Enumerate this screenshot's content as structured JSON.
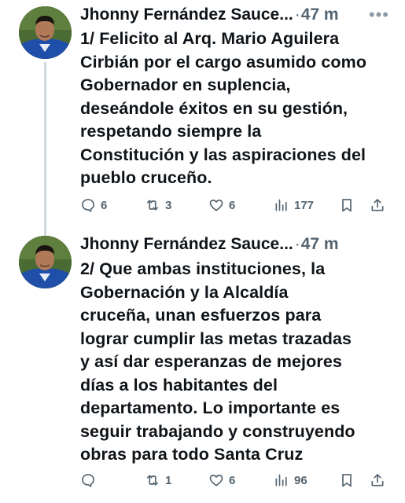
{
  "tweets": [
    {
      "author": "Jhonny Fernández Sauce...",
      "time": "47 m",
      "text": "1/ Felicito al Arq. Mario Aguilera\nCirbián por el cargo asumido como\nGobernador en suplencia,\ndeseándole éxitos en su gestión,\nrespetando siempre la\nConstitución y las aspiraciones del\npueblo cruceño.",
      "replies": "6",
      "reposts": "3",
      "likes": "6",
      "views": "177"
    },
    {
      "author": "Jhonny Fernández Sauce...",
      "time": "47 m",
      "text": "2/ Que ambas instituciones, la\nGobernación y la Alcaldía\ncruceña, unan esfuerzos para\nlograr cumplir las metas trazadas\ny así dar esperanzas de mejores\ndías a los habitantes del\ndepartamento. Lo importante es\nseguir trabajando y construyendo\nobras para todo Santa Cruz",
      "replies": "",
      "reposts": "1",
      "likes": "6",
      "views": "96"
    }
  ],
  "ui": {
    "separator": "·",
    "more_glyph": "•••"
  },
  "icons": [
    "reply-icon",
    "repost-icon",
    "like-icon",
    "views-icon",
    "bookmark-icon",
    "share-icon",
    "more-icon"
  ],
  "colors": {
    "text": "#0f1419",
    "secondary": "#536471",
    "thread_line": "#cfd9de",
    "background": "#ffffff"
  }
}
